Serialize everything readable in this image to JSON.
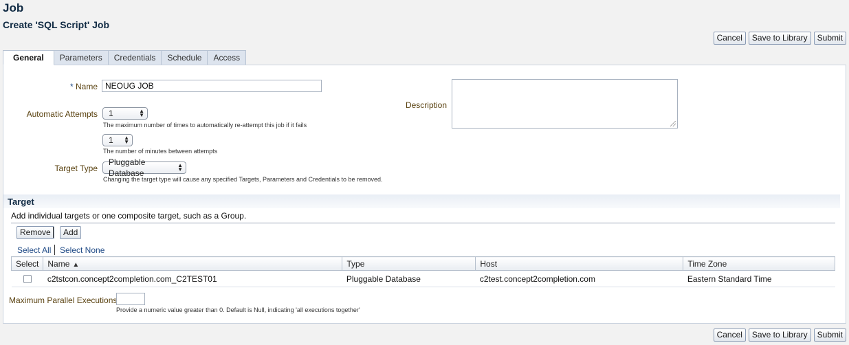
{
  "page": {
    "title": "Job",
    "subtitle": "Create 'SQL Script' Job"
  },
  "actions": {
    "cancel": "Cancel",
    "save_to_library": "Save to Library",
    "submit": "Submit"
  },
  "tabs": [
    {
      "label": "General",
      "active": true
    },
    {
      "label": "Parameters"
    },
    {
      "label": "Credentials"
    },
    {
      "label": "Schedule"
    },
    {
      "label": "Access"
    }
  ],
  "general": {
    "name_required_marker": "*",
    "name_label": "Name",
    "name_value": "NEOUG JOB",
    "description_label": "Description",
    "description_value": "",
    "attempts_label": "Automatic Attempts",
    "attempts_value": "1",
    "attempts_hint": "The maximum number of times to automatically re-attempt this job if it fails",
    "minutes_value": "1",
    "minutes_hint": "The number of minutes between attempts",
    "target_type_label": "Target Type",
    "target_type_value": "Pluggable Database",
    "target_type_hint": "Changing the target type will cause any specified Targets, Parameters and Credentials to be removed."
  },
  "target": {
    "header": "Target",
    "description": "Add individual targets or one composite target, such as a Group.",
    "remove_label": "Remove",
    "add_label": "Add",
    "select_all": "Select All",
    "select_none": "Select None",
    "columns": [
      "Select",
      "Name",
      "Type",
      "Host",
      "Time Zone"
    ],
    "rows": [
      {
        "name": "c2tstcon.concept2completion.com_C2TEST01",
        "type": "Pluggable Database",
        "host": "c2test.concept2completion.com",
        "time_zone": "Eastern Standard Time"
      }
    ]
  },
  "parallel": {
    "label": "Maximum Parallel Executions",
    "value": "",
    "hint": "Provide a numeric value greater than 0. Default is Null, indicating 'all executions together'"
  }
}
